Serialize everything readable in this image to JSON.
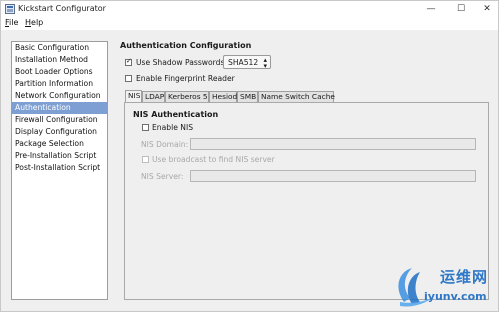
{
  "window": {
    "title": "Kickstart Configurator",
    "minimize_glyph": "—",
    "maximize_glyph": "☐",
    "close_glyph": "✕"
  },
  "menu": {
    "file": {
      "mnemonic": "F",
      "rest": "ile"
    },
    "help": {
      "mnemonic": "H",
      "rest": "elp"
    }
  },
  "sidebar": {
    "items": [
      {
        "label": "Basic Configuration",
        "selected": false
      },
      {
        "label": "Installation Method",
        "selected": false
      },
      {
        "label": "Boot Loader Options",
        "selected": false
      },
      {
        "label": "Partition Information",
        "selected": false
      },
      {
        "label": "Network Configuration",
        "selected": false
      },
      {
        "label": "Authentication",
        "selected": true
      },
      {
        "label": "Firewall Configuration",
        "selected": false
      },
      {
        "label": "Display Configuration",
        "selected": false
      },
      {
        "label": "Package Selection",
        "selected": false
      },
      {
        "label": "Pre-Installation Script",
        "selected": false
      },
      {
        "label": "Post-Installation Script",
        "selected": false
      }
    ]
  },
  "auth": {
    "title": "Authentication Configuration",
    "shadow_label": "Use Shadow Passwords",
    "shadow_checked": true,
    "hash_value": "SHA512",
    "fingerprint_label": "Enable Fingerprint Reader",
    "fingerprint_checked": false,
    "check_glyph": "✓"
  },
  "tabs": [
    {
      "label": "NIS",
      "active": true
    },
    {
      "label": "LDAP",
      "active": false
    },
    {
      "label": "Kerberos 5",
      "active": false
    },
    {
      "label": "Hesiod",
      "active": false
    },
    {
      "label": "SMB",
      "active": false
    },
    {
      "label": "Name Switch Cache",
      "active": false
    }
  ],
  "nis": {
    "title": "NIS Authentication",
    "enable_label": "Enable NIS",
    "enable_checked": false,
    "domain_label": "NIS Domain:",
    "domain_value": "",
    "broadcast_label": "Use broadcast to find NIS server",
    "broadcast_checked": false,
    "server_label": "NIS Server:",
    "server_value": ""
  },
  "watermark": {
    "cn_text": "运维网",
    "url_text": "iyunv.com"
  },
  "colors": {
    "selection": "#7d9fd3",
    "watermark_blue": "#2f78c8"
  }
}
